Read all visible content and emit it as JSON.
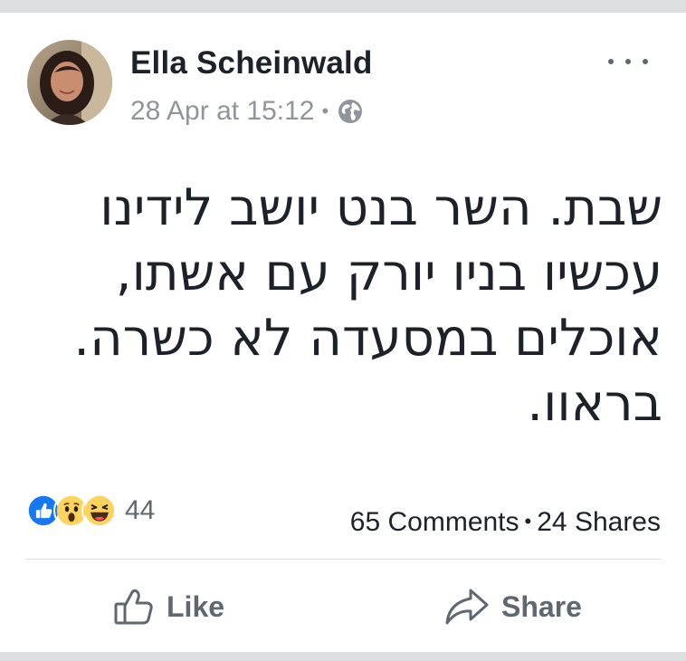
{
  "post": {
    "author": "Ella Scheinwald",
    "timestamp": "28 Apr at 15:12",
    "separator": "•",
    "privacy_icon": "globe-icon",
    "text": "שבת. השר בנט יושב לידינו\nעכשיו בניו יורק עם אשתו,\nאוכלים במסעדה לא כשרה.\nבראוו."
  },
  "reactions": {
    "icons": [
      "like-reaction-icon",
      "wow-reaction-icon",
      "haha-reaction-icon"
    ],
    "count": "44"
  },
  "stats": {
    "comments": "65 Comments",
    "separator": "•",
    "shares": "24 Shares"
  },
  "actions": {
    "like_label": "Like",
    "share_label": "Share"
  },
  "colors": {
    "like_blue": "#1877f2",
    "reaction_yellow": "#fcd35c",
    "secondary_text": "#606770"
  }
}
